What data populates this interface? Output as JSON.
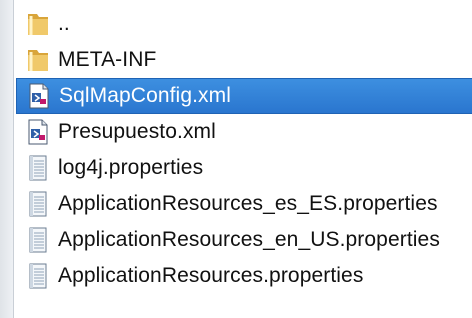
{
  "file_list": {
    "items": [
      {
        "label": "..",
        "icon": "folder-icon",
        "selected": false
      },
      {
        "label": "META-INF",
        "icon": "folder-icon",
        "selected": false
      },
      {
        "label": "SqlMapConfig.xml",
        "icon": "xml-file-icon",
        "selected": true
      },
      {
        "label": "Presupuesto.xml",
        "icon": "xml-file-icon",
        "selected": false
      },
      {
        "label": "log4j.properties",
        "icon": "text-file-icon",
        "selected": false
      },
      {
        "label": "ApplicationResources_es_ES.properties",
        "icon": "text-file-icon",
        "selected": false
      },
      {
        "label": "ApplicationResources_en_US.properties",
        "icon": "text-file-icon",
        "selected": false
      },
      {
        "label": "ApplicationResources.properties",
        "icon": "text-file-icon",
        "selected": false
      }
    ]
  },
  "colors": {
    "selection": "#2a76cf",
    "folder": "#e8b54a"
  }
}
